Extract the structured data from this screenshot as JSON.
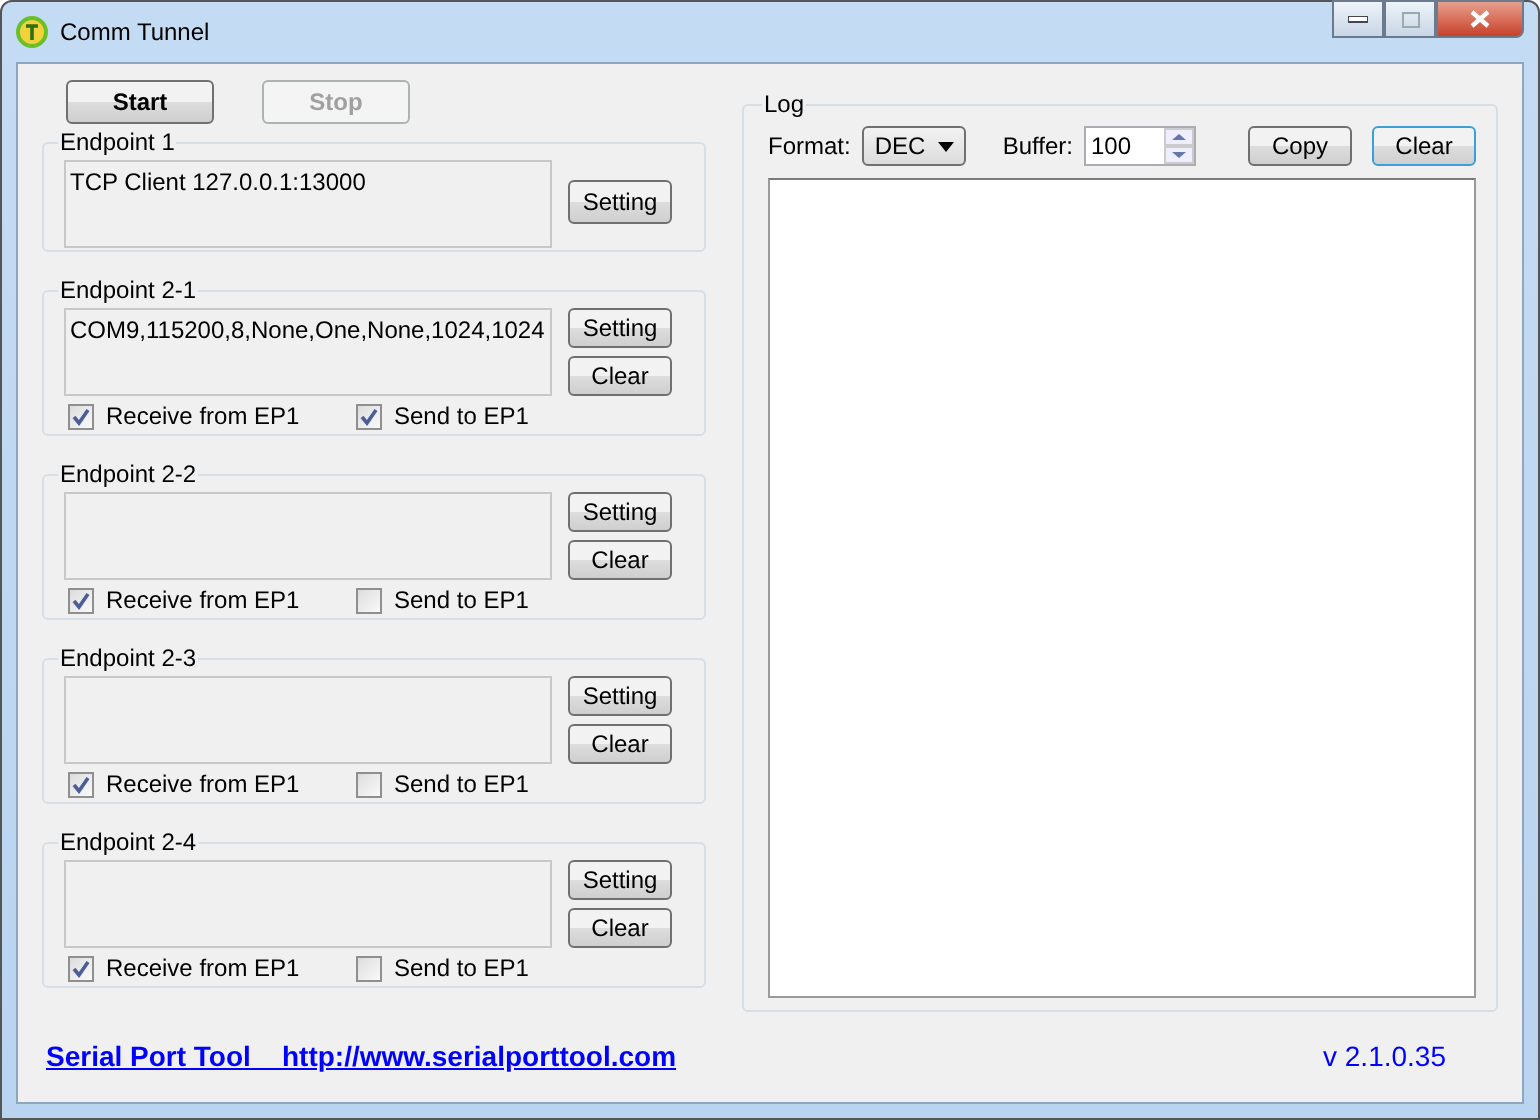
{
  "window": {
    "title": "Comm Tunnel"
  },
  "controls": {
    "start": {
      "label": "Start",
      "disabled": false
    },
    "stop": {
      "label": "Stop",
      "disabled": true
    }
  },
  "endpoints": [
    {
      "kind": "main",
      "title": "Endpoint 1",
      "info": "TCP Client 127.0.0.1:13000",
      "setting": "Setting"
    },
    {
      "kind": "sub",
      "title": "Endpoint 2-1",
      "info": "COM9,115200,8,None,One,None,1024,1024",
      "setting": "Setting",
      "clear": "Clear",
      "receive": {
        "label": "Receive from EP1",
        "checked": true
      },
      "send": {
        "label": "Send to EP1",
        "checked": true
      }
    },
    {
      "kind": "sub",
      "title": "Endpoint 2-2",
      "setting": "Setting",
      "clear": "Clear",
      "receive": {
        "label": "Receive from EP1",
        "checked": true
      },
      "send": {
        "label": "Send to EP1",
        "checked": false
      }
    },
    {
      "kind": "sub",
      "title": "Endpoint 2-3",
      "setting": "Setting",
      "clear": "Clear",
      "receive": {
        "label": "Receive from EP1",
        "checked": true
      },
      "send": {
        "label": "Send to EP1",
        "checked": false
      }
    },
    {
      "kind": "sub",
      "title": "Endpoint 2-4",
      "setting": "Setting",
      "clear": "Clear",
      "receive": {
        "label": "Receive from EP1",
        "checked": true
      },
      "send": {
        "label": "Send to EP1",
        "checked": false
      }
    }
  ],
  "log": {
    "title": "Log",
    "format_label": "Format:",
    "format_value": "DEC",
    "buffer_label": "Buffer:",
    "buffer_value": "100",
    "copy": "Copy",
    "clear": "Clear"
  },
  "footer": {
    "link": "Serial Port Tool    http://www.serialporttool.com",
    "version": "v 2.1.0.35"
  }
}
